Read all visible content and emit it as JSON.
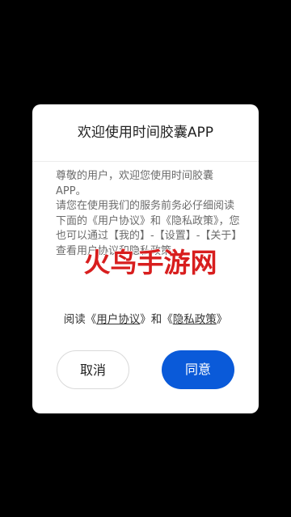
{
  "dialog": {
    "title": "欢迎使用时间胶囊APP",
    "body_paragraphs": [
      "尊敬的用户，欢迎您使用时间胶囊APP。",
      "请您在使用我们的服务前务必仔细阅读下面的《用户协议》和《隐私政策》，您也可以通过【我的】-【设置】-【关于】查看用户协议和隐私政策。"
    ],
    "agreement": {
      "prefix": "阅读《",
      "user_agreement_link": "用户协议",
      "middle": "》和《",
      "privacy_policy_link": "隐私政策",
      "suffix": "》"
    },
    "cancel_label": "取消",
    "agree_label": "同意"
  },
  "watermark": {
    "text": "火鸟手游网",
    "color": "#d81e1e"
  },
  "colors": {
    "background": "#000000",
    "dialog": "#ffffff",
    "primary": "#0a5ad9"
  }
}
